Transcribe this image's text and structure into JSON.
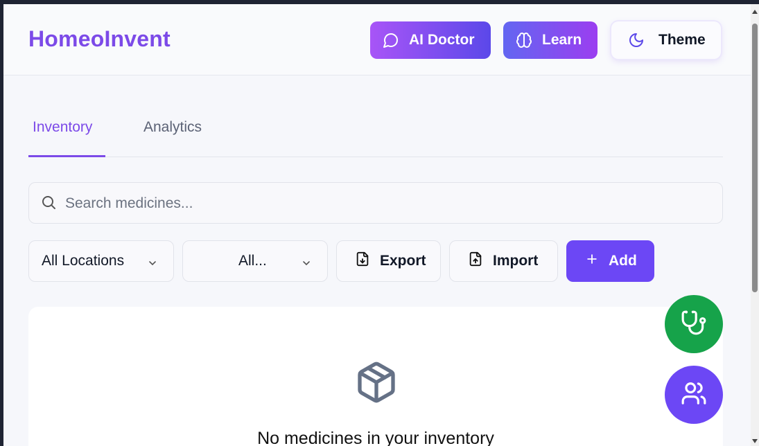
{
  "header": {
    "brand": "HomeoInvent",
    "ai_doctor_label": "AI Doctor",
    "learn_label": "Learn",
    "theme_label": "Theme"
  },
  "tabs": [
    {
      "label": "Inventory",
      "active": true
    },
    {
      "label": "Analytics",
      "active": false
    }
  ],
  "search": {
    "placeholder": "Search medicines...",
    "value": ""
  },
  "filters": {
    "location_selected": "All Locations",
    "category_selected": "All..."
  },
  "actions": {
    "export_label": "Export",
    "import_label": "Import",
    "add_label": "Add"
  },
  "empty_state": {
    "message": "No medicines in your inventory"
  },
  "icons": {
    "ai_doctor": "chat-bubble-icon",
    "learn": "brain-icon",
    "theme": "moon-icon",
    "search": "search-icon",
    "export": "file-download-icon",
    "import": "file-upload-icon",
    "add": "plus-icon",
    "empty": "package-icon",
    "fab_doctor": "stethoscope-icon",
    "fab_users": "users-icon"
  },
  "colors": {
    "brand": "#7c4ae8",
    "primary": "#6c47f5",
    "fab_green": "#16a34a"
  }
}
